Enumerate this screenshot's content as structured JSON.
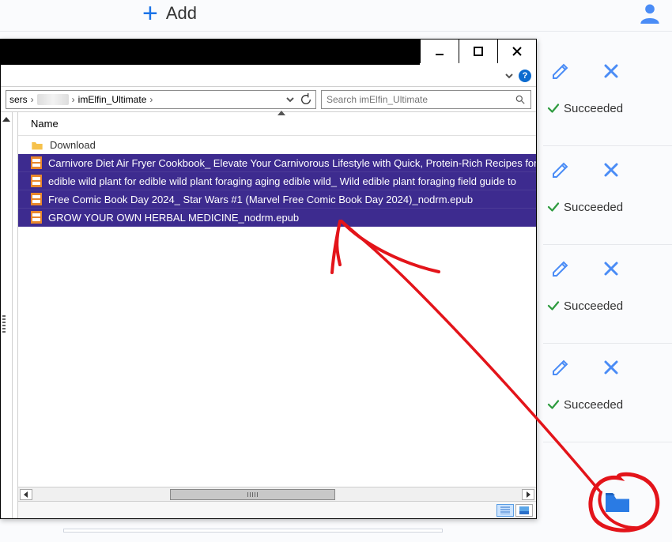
{
  "toolbar": {
    "add_label": "Add"
  },
  "side_status": {
    "items": [
      {
        "label": "Succeeded"
      },
      {
        "label": "Succeeded"
      },
      {
        "label": "Succeeded"
      },
      {
        "label": "Succeeded"
      }
    ]
  },
  "explorer": {
    "breadcrumb": {
      "seg0": "sers",
      "seg1": "imElfin_Ultimate"
    },
    "search_placeholder": "Search imElfin_Ultimate",
    "column_header": "Name",
    "folder_label": "Download",
    "files": [
      "Carnivore Diet Air Fryer Cookbook_ Elevate Your Carnivorous Lifestyle with Quick, Protein-Rich Recipes for",
      "edible wild plant for edible wild plant foraging aging edible wild_ Wild edible plant foraging field guide to",
      "Free Comic Book Day 2024_ Star Wars #1 (Marvel Free Comic Book Day 2024)_nodrm.epub",
      "GROW YOUR OWN HERBAL MEDICINE_nodrm.epub"
    ]
  }
}
